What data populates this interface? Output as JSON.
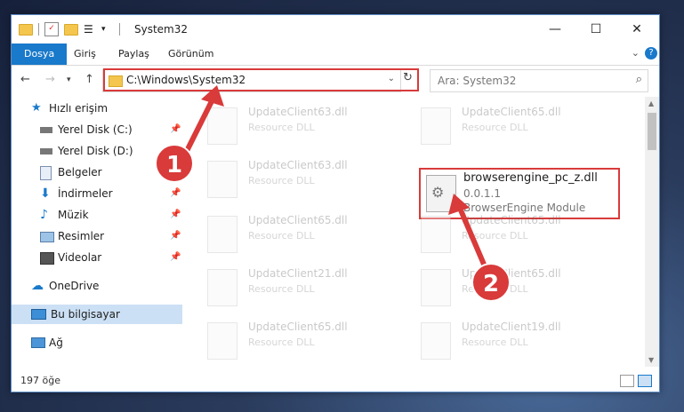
{
  "window": {
    "title": "System32"
  },
  "ribbon": {
    "tabs": [
      "Dosya",
      "Giriş",
      "Paylaş",
      "Görünüm"
    ]
  },
  "address": {
    "path": "C:\\Windows\\System32"
  },
  "search": {
    "placeholder": "Ara: System32"
  },
  "sidebar": {
    "items": [
      {
        "label": "Hızlı erişim",
        "icon": "star-icon"
      },
      {
        "label": "Yerel Disk (C:)",
        "icon": "drive-icon"
      },
      {
        "label": "Yerel Disk (D:)",
        "icon": "drive-icon"
      },
      {
        "label": "Belgeler",
        "icon": "documents-icon"
      },
      {
        "label": "İndirmeler",
        "icon": "download-icon"
      },
      {
        "label": "Müzik",
        "icon": "music-icon"
      },
      {
        "label": "Resimler",
        "icon": "pictures-icon"
      },
      {
        "label": "Videolar",
        "icon": "video-icon"
      },
      {
        "label": "OneDrive",
        "icon": "cloud-icon"
      },
      {
        "label": "Bu bilgisayar",
        "icon": "computer-icon"
      },
      {
        "label": "Ağ",
        "icon": "network-icon"
      }
    ]
  },
  "files": [
    {
      "name": "UpdateClient63.dll",
      "desc": "Resource DLL"
    },
    {
      "name": "UpdateClient65.dll",
      "desc": "Resource DLL"
    },
    {
      "name": "UpdateClient63.dll",
      "desc": "Resource DLL"
    },
    {
      "name": "UpdateClient65.dll",
      "desc": "Resource DLL"
    },
    {
      "name": "UpdateClient65.dll",
      "desc": "Resource DLL"
    },
    {
      "name": "UpdateClient21.dll",
      "desc": "Resource DLL"
    },
    {
      "name": "UpdateClient65.dll",
      "desc": "Resource DLL"
    },
    {
      "name": "UpdateClient65.dll",
      "desc": "Resource DLL"
    },
    {
      "name": "UpdateClient19.dll",
      "desc": "Resource DLL"
    }
  ],
  "highlighted_file": {
    "name": "browserengine_pc_z.dll",
    "version": "0.0.1.1",
    "desc": "BrowserEngine Module"
  },
  "status": {
    "count": "197 öğe"
  },
  "callouts": {
    "one": "1",
    "two": "2"
  },
  "colors": {
    "accent": "#1979ca",
    "highlight": "#d93a3a"
  }
}
